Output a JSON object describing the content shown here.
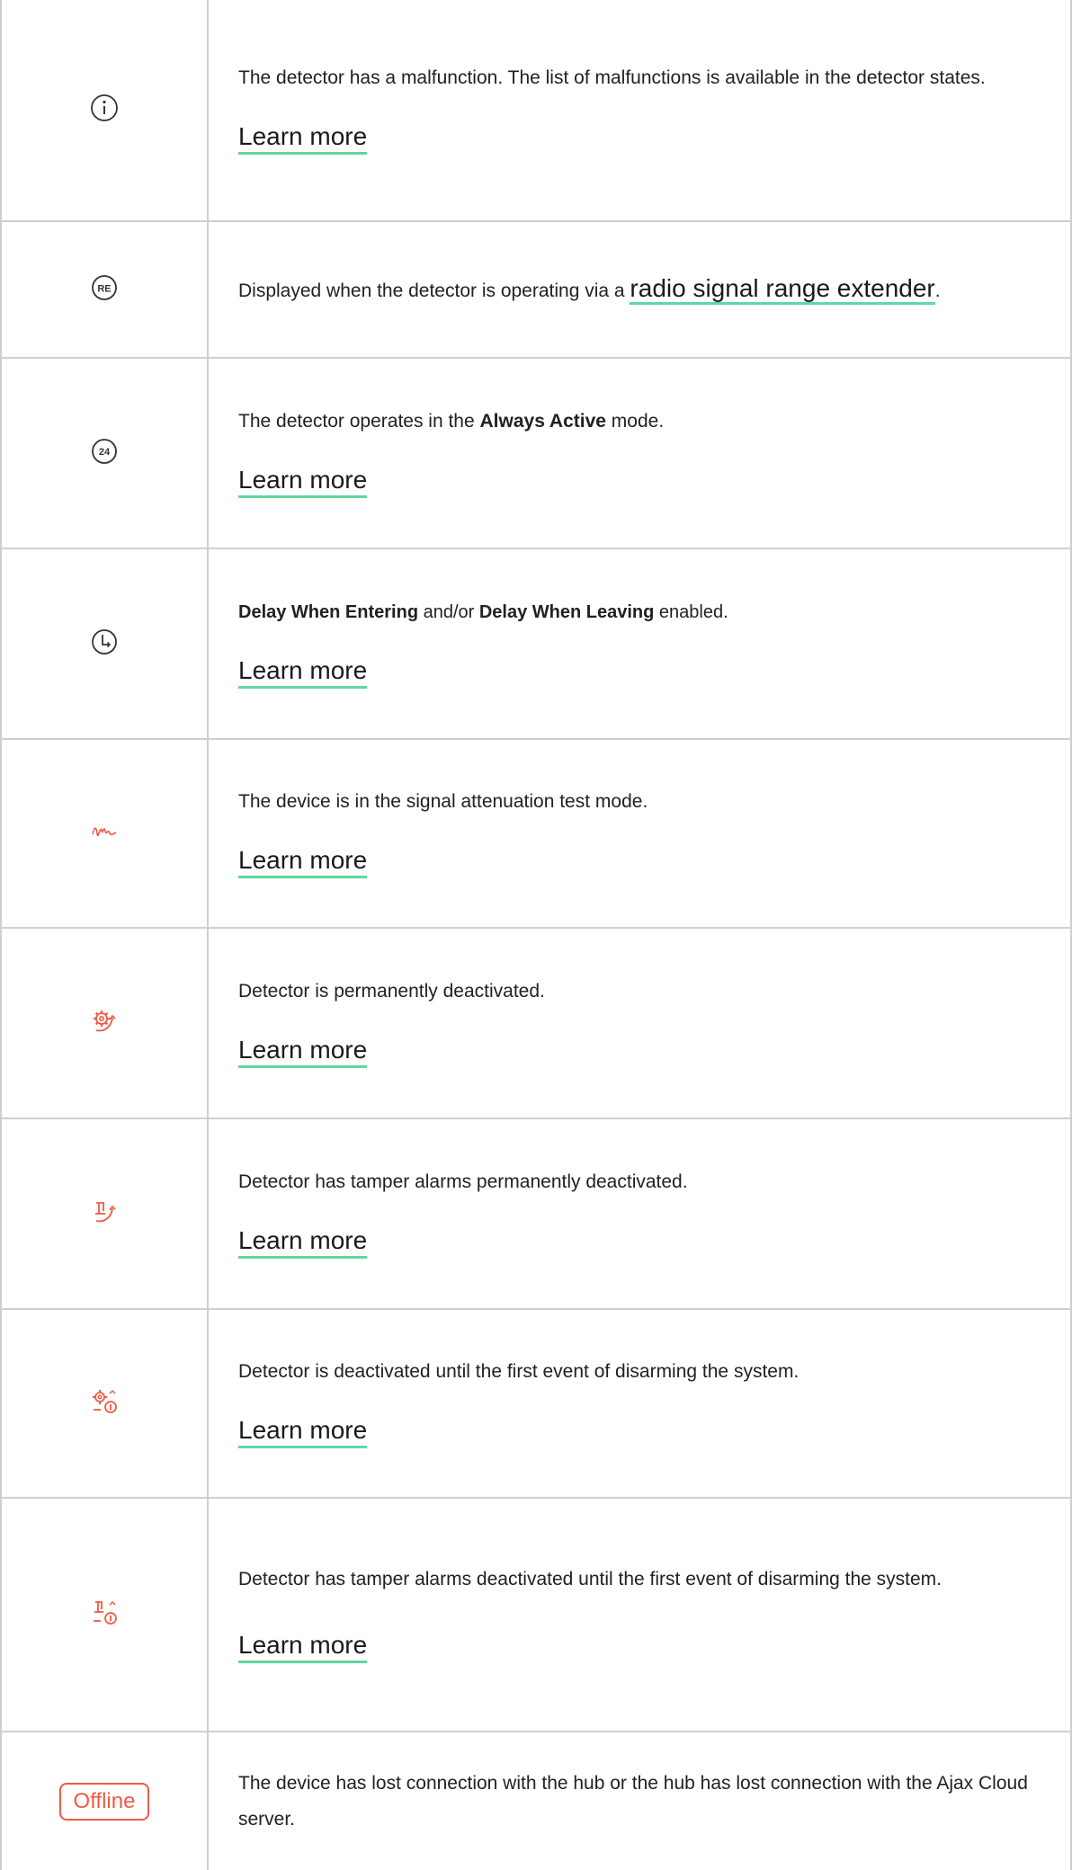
{
  "colors": {
    "accent_underline": "#5fd8a0",
    "alert": "#f05a45",
    "grid": "#cfcfcf"
  },
  "rows": [
    {
      "icon": "info-circle-icon",
      "text": "The detector has a malfunction. The list of malfunctions is available in the detector states.",
      "link": "Learn more"
    },
    {
      "icon": "range-extender-re-icon",
      "text_before": "Displayed when the detector is operating via a ",
      "link": "radio signal range extender",
      "text_after": "."
    },
    {
      "icon": "always-active-24-icon",
      "text_before": "The detector operates in the ",
      "bold": "Always Active",
      "text_after": " mode.",
      "link": "Learn more"
    },
    {
      "icon": "delay-clock-icon",
      "bold1": "Delay When Entering",
      "mid": " and/or ",
      "bold2": "Delay When Leaving",
      "text_after": " enabled.",
      "link": "Learn more"
    },
    {
      "icon": "signal-attenuation-wave-icon",
      "text": "The device is in the signal attenuation test mode.",
      "link": "Learn more"
    },
    {
      "icon": "gear-deactivated-icon",
      "text": "Detector is permanently deactivated.",
      "link": "Learn more"
    },
    {
      "icon": "tamper-deactivated-icon",
      "text": "Detector has tamper alarms permanently deactivated.",
      "link": "Learn more"
    },
    {
      "icon": "gear-deactivated-once-icon",
      "text": "Detector is deactivated until the first event of disarming the system.",
      "link": "Learn more"
    },
    {
      "icon": "tamper-deactivated-once-icon",
      "text": "Detector has tamper alarms deactivated until the first event of disarming the system.",
      "link": "Learn more"
    },
    {
      "badge": "Offline",
      "text": "The device has lost connection with the hub or the hub has lost connection with the Ajax Cloud server."
    }
  ]
}
